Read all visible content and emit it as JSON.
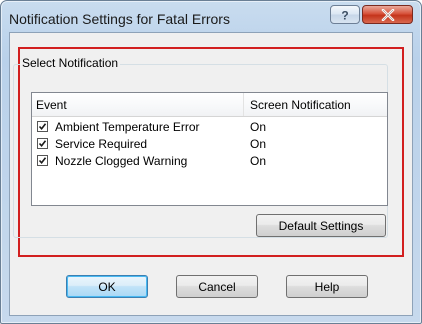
{
  "window": {
    "title": "Notification Settings for Fatal Errors"
  },
  "titlebar_buttons": {
    "help_label": "?",
    "close_label": "x"
  },
  "group": {
    "label": "Select Notification"
  },
  "list": {
    "columns": [
      "Event",
      "Screen Notification"
    ],
    "rows": [
      {
        "event": "Ambient Temperature Error",
        "status": "On",
        "checked": true
      },
      {
        "event": "Service Required",
        "status": "On",
        "checked": true
      },
      {
        "event": "Nozzle Clogged Warning",
        "status": "On",
        "checked": true
      }
    ]
  },
  "buttons": {
    "default_settings": "Default Settings",
    "ok": "OK",
    "cancel": "Cancel",
    "help": "Help"
  },
  "colors": {
    "highlight_frame": "#d21f1f",
    "close_button": "#c4341b"
  }
}
